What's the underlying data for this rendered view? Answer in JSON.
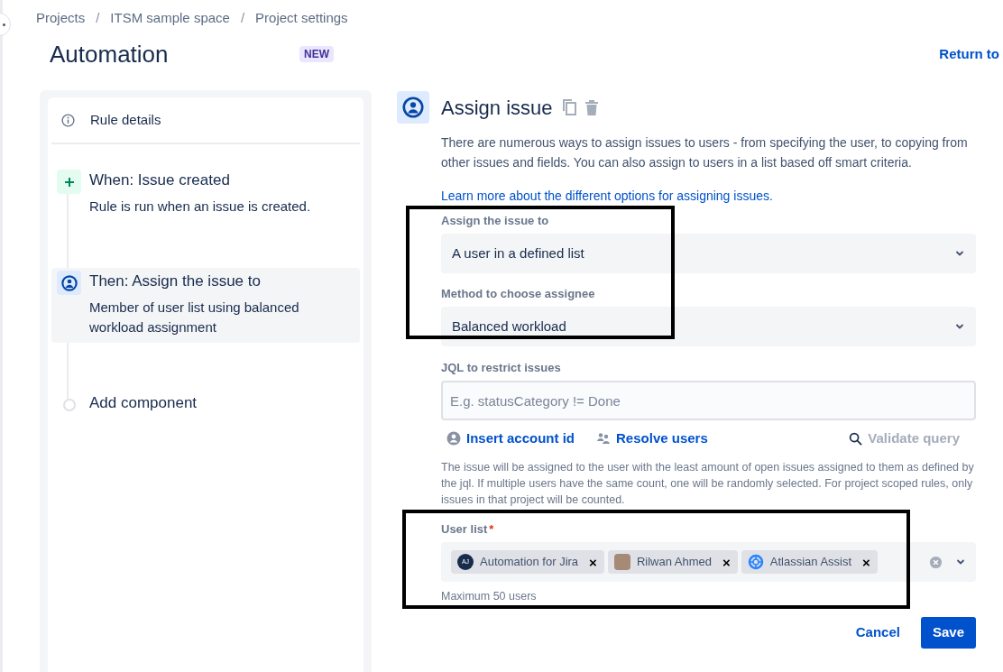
{
  "breadcrumbs": [
    {
      "kind": "link",
      "text": "Projects"
    },
    {
      "kind": "separator",
      "text": "/"
    },
    {
      "kind": "link",
      "text": "ITSM sample space"
    },
    {
      "kind": "separator",
      "text": "/"
    },
    {
      "kind": "link",
      "text": "Project settings"
    }
  ],
  "page_title": "Automation",
  "badge": "NEW",
  "return_link": "Return to",
  "rule_details": "Rule details",
  "steps": [
    {
      "kind": "trigger",
      "title": "When: Issue created",
      "description": "Rule is run when an issue is created.",
      "selected": false
    },
    {
      "kind": "action",
      "title": "Then: Assign the issue to",
      "description": "Member of user list using balanced workload assignment",
      "selected": true
    },
    {
      "kind": "add",
      "title": "Add component",
      "selected": false
    }
  ],
  "action": {
    "title": "Assign issue",
    "description": "There are numerous ways to assign issues to users - from specifying the user, to copying from other issues and fields. You can also assign to users in a list based off smart criteria.",
    "learn_more": "Learn more about the different options for assigning issues.",
    "assignment_highlighted": true,
    "assign_to": {
      "label": "Assign the issue to",
      "value": "A user in a defined list"
    },
    "method": {
      "label": "Method to choose assignee",
      "value": "Balanced workload"
    },
    "jql": {
      "label": "JQL to restrict issues",
      "placeholder": "E.g. statusCategory != Done"
    },
    "jql_actions": [
      {
        "kind": "account",
        "label": "Insert account id",
        "disabled": false
      },
      {
        "kind": "users",
        "label": "Resolve users",
        "disabled": false
      },
      {
        "kind": "validate",
        "label": "Validate query",
        "disabled": true
      }
    ],
    "jql_help": "The issue will be assigned to the user with the least amount of open issues assigned to them as defined by the jql. If multiple users have the same count, one will be randomly selected. For project scoped rules, only issues in that project will be counted.",
    "user_list": {
      "label": "User list",
      "required_mark": "*",
      "highlighted": true,
      "helper": "Maximum 50 users",
      "users": [
        {
          "kind": "initials",
          "initials": "AJ",
          "name": "Automation for Jira",
          "remove": "×"
        },
        {
          "kind": "photo",
          "name": "Rilwan Ahmed",
          "remove": "×"
        },
        {
          "kind": "app",
          "name": "Atlassian Assist",
          "remove": "×"
        }
      ]
    },
    "buttons": {
      "cancel": "Cancel",
      "save": "Save"
    }
  }
}
